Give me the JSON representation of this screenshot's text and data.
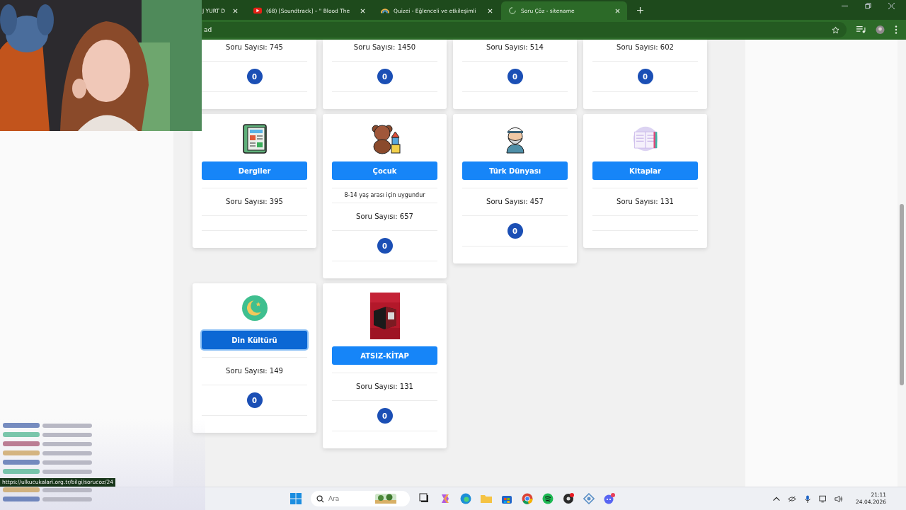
{
  "browser": {
    "tabs": [
      {
        "title": "J YURT D",
        "selected": false,
        "kind": "plain"
      },
      {
        "title": "(68) [Soundtrack] – \" Blood The",
        "selected": false,
        "kind": "video"
      },
      {
        "title": "Quizei - Eğlenceli ve etkileşimli",
        "selected": false,
        "kind": "quiz"
      },
      {
        "title": "Soru Çöz - sitename",
        "selected": true,
        "kind": "loading"
      }
    ],
    "address": "ad"
  },
  "webcam": {
    "kind": "picture"
  },
  "card_rows": [
    [
      {
        "count": "Soru Sayısı: 745",
        "badge": "0"
      },
      {
        "count": "Soru Sayısı: 1450",
        "badge": "0"
      },
      {
        "count": "Soru Sayısı: 514",
        "badge": "0"
      },
      {
        "count": "Soru Sayısı: 602",
        "badge": "0"
      }
    ],
    [
      {
        "kind": "newspaper",
        "title": "Dergiler",
        "count": "Soru Sayısı: 395",
        "focused": false
      },
      {
        "kind": "teddy",
        "title": "Çocuk",
        "description": "8-14 yaş arası için uygundur",
        "count": "Soru Sayısı: 657",
        "badge": "0",
        "focused": false
      },
      {
        "kind": "sailor",
        "title": "Türk Dünyası",
        "count": "Soru Sayısı: 457",
        "badge": "0",
        "focused": false
      },
      {
        "kind": "book",
        "title": "Kitaplar",
        "count": "Soru Sayısı: 131",
        "focused": false
      }
    ],
    [
      {
        "kind": "crescent",
        "title": "Din Kültürü",
        "count": "Soru Sayısı: 149",
        "badge": "0",
        "focused": true
      },
      {
        "kind": "picture",
        "title": "ATSIZ-KİTAP",
        "count": "Soru Sayısı: 131",
        "badge": "0",
        "focused": false
      }
    ]
  ],
  "status_link": "https://ulkucukalari.org.tr/bilgi/sorucoz/24",
  "taskbar": {
    "search_placeholder": "Ara",
    "time": "21:11",
    "date": "24.04.2026"
  }
}
